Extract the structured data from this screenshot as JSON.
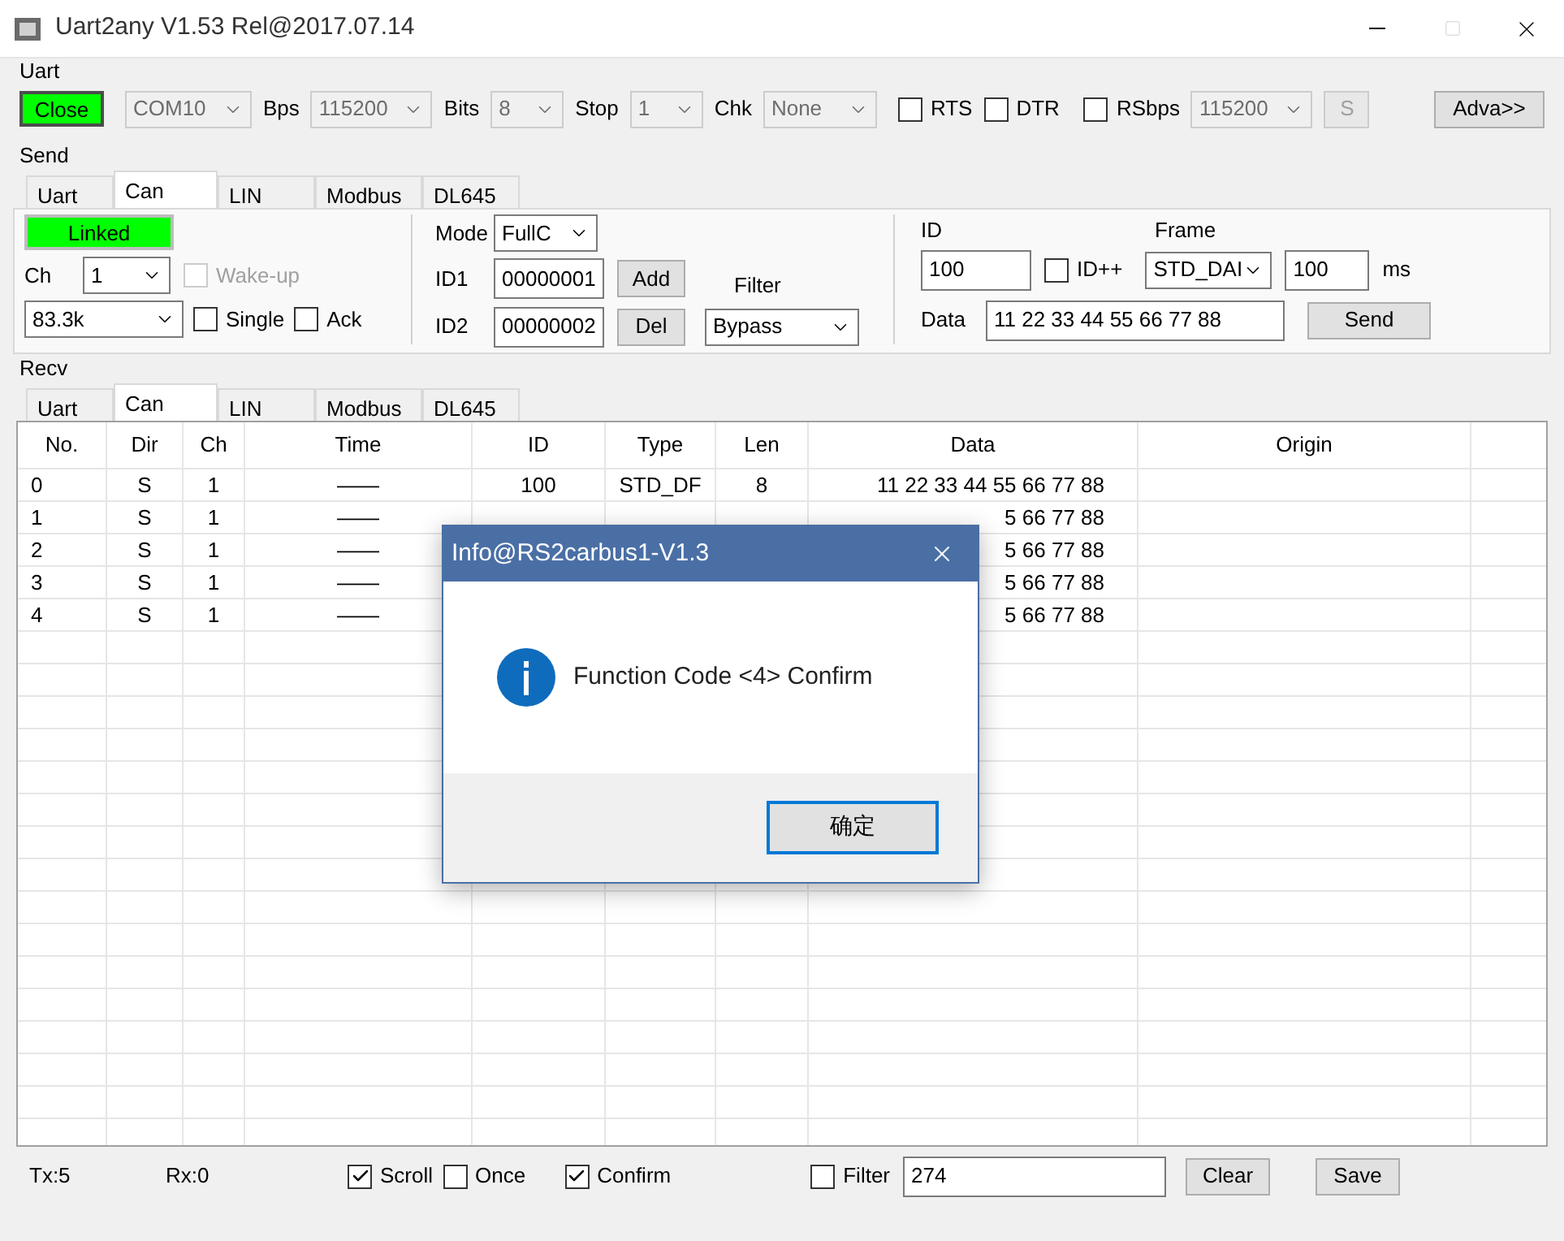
{
  "window": {
    "title": "Uart2any V1.53 Rel@2017.07.14"
  },
  "uart": {
    "label": "Uart",
    "close_button": "Close",
    "port": {
      "value": "COM10",
      "disabled": true
    },
    "bps_label": "Bps",
    "bps": {
      "value": "115200",
      "disabled": true
    },
    "bits_label": "Bits",
    "bits": {
      "value": "8",
      "disabled": true
    },
    "stop_label": "Stop",
    "stop": {
      "value": "1",
      "disabled": true
    },
    "chk_label": "Chk",
    "chk": {
      "value": "None",
      "disabled": true
    },
    "rts": {
      "label": "RTS",
      "checked": false,
      "disabled": false
    },
    "dtr": {
      "label": "DTR",
      "checked": false,
      "disabled": false
    },
    "rsbps": {
      "label": "RSbps",
      "checked": false,
      "disabled": false
    },
    "rsbps_value": {
      "value": "115200",
      "disabled": true
    },
    "s_button": {
      "label": "S",
      "disabled": true
    },
    "adva_button": "Adva>>"
  },
  "send": {
    "label": "Send",
    "tabs": [
      {
        "label": "Uart",
        "selected": false
      },
      {
        "label": "Can",
        "selected": true
      },
      {
        "label": "LIN",
        "selected": false
      },
      {
        "label": "Modbus",
        "selected": false
      },
      {
        "label": "DL645",
        "selected": false
      }
    ],
    "linked": "Linked",
    "ch_label": "Ch",
    "ch": {
      "value": "1",
      "disabled": false
    },
    "wakeup": {
      "label": "Wake-up",
      "checked": false,
      "disabled": true
    },
    "speed": {
      "value": "83.3k",
      "disabled": false
    },
    "single": {
      "label": "Single",
      "checked": false,
      "disabled": false
    },
    "ack": {
      "label": "Ack",
      "checked": false,
      "disabled": false
    },
    "mode_label": "Mode",
    "mode": {
      "value": "FullC",
      "disabled": false
    },
    "id1_label": "ID1",
    "id1": "00000001",
    "add_button": "Add",
    "id2_label": "ID2",
    "id2": "00000002",
    "del_button": "Del",
    "filter_label": "Filter",
    "filter": {
      "value": "Bypass",
      "disabled": false
    },
    "id_label": "ID",
    "id_value": "100",
    "idpp": {
      "label": "ID++",
      "checked": false,
      "disabled": false
    },
    "frame_label": "Frame",
    "frame": {
      "value": "STD_DAI",
      "disabled": false
    },
    "interval": "100",
    "ms_label": "ms",
    "data_label": "Data",
    "data": "11 22 33 44 55 66 77 88",
    "send_button": "Send"
  },
  "recv": {
    "label": "Recv",
    "tabs": [
      {
        "label": "Uart",
        "selected": false
      },
      {
        "label": "Can",
        "selected": true
      },
      {
        "label": "LIN",
        "selected": false
      },
      {
        "label": "Modbus",
        "selected": false
      },
      {
        "label": "DL645",
        "selected": false
      }
    ],
    "table": {
      "columns": [
        "No.",
        "Dir",
        "Ch",
        "Time",
        "ID",
        "Type",
        "Len",
        "Data",
        "Origin"
      ],
      "rows": [
        {
          "no": "0",
          "dir": "S",
          "ch": "1",
          "time": "——",
          "id": "100",
          "type": "STD_DF",
          "len": "8",
          "data": "11 22 33 44 55 66 77 88"
        },
        {
          "no": "1",
          "dir": "S",
          "ch": "1",
          "time": "——",
          "data": "5 66 77 88"
        },
        {
          "no": "2",
          "dir": "S",
          "ch": "1",
          "time": "——",
          "data": "5 66 77 88"
        },
        {
          "no": "3",
          "dir": "S",
          "ch": "1",
          "time": "——",
          "data": "5 66 77 88"
        },
        {
          "no": "4",
          "dir": "S",
          "ch": "1",
          "time": "——",
          "data": "5 66 77 88"
        }
      ]
    }
  },
  "status": {
    "tx": "Tx:5",
    "rx": "Rx:0",
    "scroll": {
      "label": "Scroll",
      "checked": true,
      "disabled": false
    },
    "once": {
      "label": "Once",
      "checked": false,
      "disabled": false
    },
    "confirm": {
      "label": "Confirm",
      "checked": true,
      "disabled": false
    },
    "filter": {
      "label": "Filter",
      "checked": false,
      "disabled": false
    },
    "filter_value": "274",
    "clear_button": "Clear",
    "save_button": "Save"
  },
  "dialog": {
    "title": "Info@RS2carbus1-V1.3",
    "message": "Function Code <4> Confirm",
    "ok_button": "确定"
  }
}
